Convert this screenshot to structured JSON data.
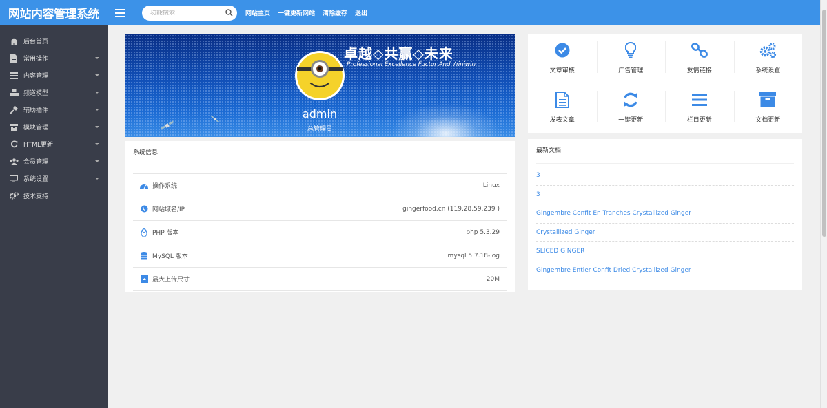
{
  "app": {
    "title": "网站内容管理系统"
  },
  "search": {
    "placeholder": "功能搜索"
  },
  "toplinks": [
    "网站主页",
    "一键更新网站",
    "清除缓存",
    "退出"
  ],
  "sidebar": {
    "items": [
      {
        "label": "后台首页",
        "icon": "home-icon",
        "has_caret": false
      },
      {
        "label": "常用操作",
        "icon": "document-icon",
        "has_caret": true
      },
      {
        "label": "内容管理",
        "icon": "list-icon",
        "has_caret": true
      },
      {
        "label": "频道模型",
        "icon": "cubes-icon",
        "has_caret": true
      },
      {
        "label": "辅助插件",
        "icon": "plug-icon",
        "has_caret": true
      },
      {
        "label": "模块管理",
        "icon": "archive-icon",
        "has_caret": true
      },
      {
        "label": "HTML更新",
        "icon": "refresh-icon",
        "has_caret": true
      },
      {
        "label": "会员管理",
        "icon": "users-icon",
        "has_caret": true
      },
      {
        "label": "系统设置",
        "icon": "monitor-icon",
        "has_caret": true
      },
      {
        "label": "技术支持",
        "icon": "gears-icon",
        "has_caret": false
      }
    ]
  },
  "banner": {
    "slogan": "卓越◇共赢◇未来",
    "slogan_en": "Professional Excellence Fuctur And Winiwin",
    "username": "admin",
    "role": "总管理员"
  },
  "sysinfo": {
    "title": "系统信息",
    "rows": [
      {
        "label": "操作系统",
        "value": "Linux",
        "icon": "dashboard-icon"
      },
      {
        "label": "网站域名/IP",
        "value": "gingerfood.cn (119.28.59.239 )",
        "icon": "globe-icon"
      },
      {
        "label": "PHP 版本",
        "value": "php 5.3.29",
        "icon": "linux-icon"
      },
      {
        "label": "MySQL 版本",
        "value": "mysql 5.7.18-log",
        "icon": "database-icon"
      },
      {
        "label": "最大上传尺寸",
        "value": "20M",
        "icon": "upload-icon"
      }
    ]
  },
  "quick": {
    "items": [
      {
        "label": "文章审核",
        "icon": "check-circle-icon"
      },
      {
        "label": "广告管理",
        "icon": "lightbulb-icon"
      },
      {
        "label": "友情链接",
        "icon": "link-icon"
      },
      {
        "label": "系统设置",
        "icon": "gears-icon"
      },
      {
        "label": "发表文章",
        "icon": "file-icon"
      },
      {
        "label": "一键更新",
        "icon": "refresh-icon"
      },
      {
        "label": "栏目更新",
        "icon": "bars-icon"
      },
      {
        "label": "文档更新",
        "icon": "archive-icon"
      }
    ]
  },
  "docs": {
    "title": "最新文档",
    "items": [
      "3",
      "3",
      "Gingembre Confit En Tranches Crystallized Ginger",
      "Crystallized Ginger",
      "SLICED GINGER",
      "Gingembre Entier Confit Dried Crystallized Ginger"
    ]
  },
  "colors": {
    "accent": "#3c92e8",
    "sidebar": "#393d49",
    "link": "#3c8ae6"
  }
}
